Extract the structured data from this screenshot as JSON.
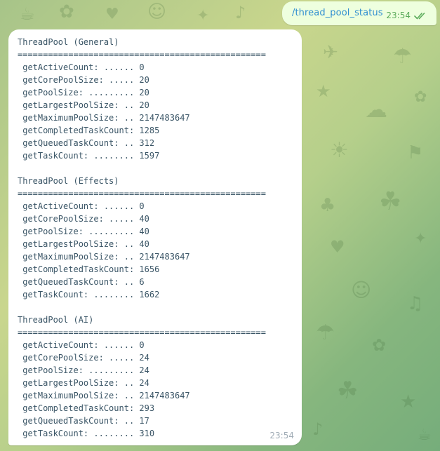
{
  "chat": {
    "outgoing": {
      "text": "/thread_pool_status",
      "time": "23:54",
      "status_icon": "double-check-icon",
      "text_color": "#2f8fd1",
      "bubble_color": "#eeffde"
    },
    "incoming": {
      "time": "23:54",
      "bubble_color": "#ffffff",
      "lines": [
        "ThreadPool (General)",
        "=================================================",
        " getActiveCount: ...... 0",
        " getCorePoolSize: ..... 20",
        " getPoolSize: ......... 20",
        " getLargestPoolSize: .. 20",
        " getMaximumPoolSize: .. 2147483647",
        " getCompletedTaskCount: 1285",
        " getQueuedTaskCount: .. 312",
        " getTaskCount: ........ 1597",
        "",
        "ThreadPool (Effects)",
        "=================================================",
        " getActiveCount: ...... 0",
        " getCorePoolSize: ..... 40",
        " getPoolSize: ......... 40",
        " getLargestPoolSize: .. 40",
        " getMaximumPoolSize: .. 2147483647",
        " getCompletedTaskCount: 1656",
        " getQueuedTaskCount: .. 6",
        " getTaskCount: ........ 1662",
        "",
        "ThreadPool (AI)",
        "=================================================",
        " getActiveCount: ...... 0",
        " getCorePoolSize: ..... 24",
        " getPoolSize: ......... 24",
        " getLargestPoolSize: .. 24",
        " getMaximumPoolSize: .. 2147483647",
        " getCompletedTaskCount: 293",
        " getQueuedTaskCount: .. 17",
        " getTaskCount: ........ 310"
      ]
    }
  }
}
